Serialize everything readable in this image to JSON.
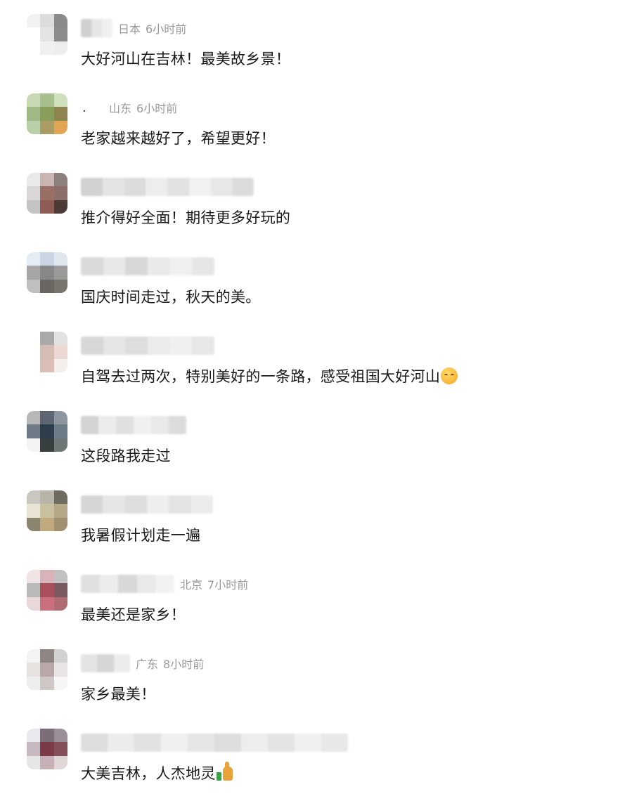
{
  "comments": [
    {
      "location": "日本",
      "time": "6小时前",
      "text": "大好河山在吉林！最美故乡景！",
      "name_style": "blur",
      "avatar_colors": [
        "#f2f2f2",
        "#dcdcdc",
        "#8a8a8a",
        "#ffffff",
        "#e4e4e4",
        "#8c8c8c",
        "#ffffff",
        "#f0f0f0",
        "#ededed"
      ],
      "name_colors": [
        "#d0d0d0",
        "#e6e6e6",
        "#f0f0f0"
      ]
    },
    {
      "location": "山东",
      "time": "6小时前",
      "text": "老家越来越好了，希望更好！",
      "name_style": "dot",
      "name_text": ".",
      "avatar_colors": [
        "#c7d9b4",
        "#a7bf8c",
        "#cfe0bd",
        "#9fb886",
        "#8a9e5b",
        "#8f8450",
        "#b9cfa7",
        "#a99c66",
        "#e2a653"
      ],
      "name_colors": []
    },
    {
      "location": "",
      "time": "",
      "text": "推介得好全面！期待更多好玩的",
      "name_style": "blur",
      "avatar_colors": [
        "#e9e9e9",
        "#c9b5b2",
        "#8c7f7c",
        "#d9d6d6",
        "#9a6f66",
        "#8b6e69",
        "#c3c3c3",
        "#8f5d55",
        "#4c3a37"
      ],
      "name_colors": [
        "#d2d2d2",
        "#e4e4e4",
        "#dcdcdc",
        "#ededed",
        "#e2e2e2",
        "#f1f1f1",
        "#e8e8e8",
        "#dcdcdc"
      ]
    },
    {
      "location": "",
      "time": "",
      "text": "国庆时间走过，秋天的美。",
      "name_style": "blur",
      "avatar_colors": [
        "#e4ecf6",
        "#c9d5e2",
        "#dfe6ee",
        "#a6a6a6",
        "#878787",
        "#9a9a9a",
        "#bfbfbf",
        "#6b6662",
        "#7a746e"
      ],
      "name_colors": [
        "#dadada",
        "#e8e8e8",
        "#d7d7d7",
        "#eaeaea",
        "#f0f0f0",
        "#e6e6e6"
      ]
    },
    {
      "location": "",
      "time": "",
      "text": "自驾去过两次，特别美好的一条路，感受祖国大好河山",
      "name_style": "blur",
      "emoji": "face",
      "avatar_colors": [
        "#ffffff",
        "#a9a9a9",
        "#e2e2e2",
        "#ffffff",
        "#d6bdb4",
        "#eed8d4",
        "#ffffff",
        "#d9bfb6",
        "#f4eeec"
      ],
      "name_colors": [
        "#d8d8d8",
        "#e5e5e5",
        "#dddddd",
        "#ebebeb",
        "#f0f0f0",
        "#e7e7e7"
      ]
    },
    {
      "location": "",
      "time": "",
      "text": "这段路我走过",
      "name_style": "blur",
      "avatar_colors": [
        "#b7b7b7",
        "#5d6670",
        "#8d96a0",
        "#6f7a86",
        "#2e3d4c",
        "#6c7d87",
        "#f4f4f4",
        "#37403e",
        "#6e7876"
      ],
      "name_colors": [
        "#d3d3d3",
        "#ececec",
        "#e0e0e0",
        "#f0f0f0",
        "#e9e9e9",
        "#dcdcdc"
      ]
    },
    {
      "location": "",
      "time": "",
      "text": "我暑假计划走一遍",
      "name_style": "blur",
      "avatar_colors": [
        "#c9c7c0",
        "#b8b5a8",
        "#6f6b60",
        "#e8e4d4",
        "#c9c0a0",
        "#b2a888",
        "#8b8570",
        "#c0a97c",
        "#a09070"
      ],
      "name_colors": [
        "#d6d6d6",
        "#e6e6e6",
        "#dedede",
        "#eeeeee",
        "#e4e4e4",
        "#ececec"
      ]
    },
    {
      "location": "北京",
      "time": "7小时前",
      "text": "最美还是家乡！",
      "name_style": "blur",
      "avatar_colors": [
        "#f0e4e6",
        "#d8b4ba",
        "#c2c2c2",
        "#b9b9b9",
        "#a8505c",
        "#7a5a5e",
        "#e8d8da",
        "#c9707c",
        "#b06a72"
      ],
      "name_colors": [
        "#e0e0e0",
        "#ececec",
        "#d8d8d8",
        "#e9e9e9",
        "#f2f2f2"
      ]
    },
    {
      "location": "广东",
      "time": "8小时前",
      "text": "家乡最美！",
      "name_style": "blur",
      "avatar_colors": [
        "#f3f3f3",
        "#8e8585",
        "#d2d2d2",
        "#e6e2e2",
        "#b8a8a8",
        "#e8e4e4",
        "#eeeeee",
        "#cfc7c7",
        "#f6f6f6"
      ],
      "name_colors": [
        "#e4e4e4",
        "#d6d6d6",
        "#ececec"
      ]
    },
    {
      "location": "",
      "time": "",
      "text": "大美吉林，人杰地灵",
      "name_style": "blur",
      "emoji": "thumb",
      "avatar_colors": [
        "#e9e9ee",
        "#7b6e78",
        "#9a8f98",
        "#c8b8c0",
        "#7a3a46",
        "#86505a",
        "#e6e6e6",
        "#c7b0b6",
        "#e0d6d8"
      ],
      "name_colors": [
        "#dedede",
        "#ececec",
        "#e2e2e2",
        "#efefef",
        "#e5e5e5",
        "#dddddd",
        "#ededed",
        "#e4e4e4",
        "#f0f0f0",
        "#e8e8e8"
      ]
    }
  ]
}
